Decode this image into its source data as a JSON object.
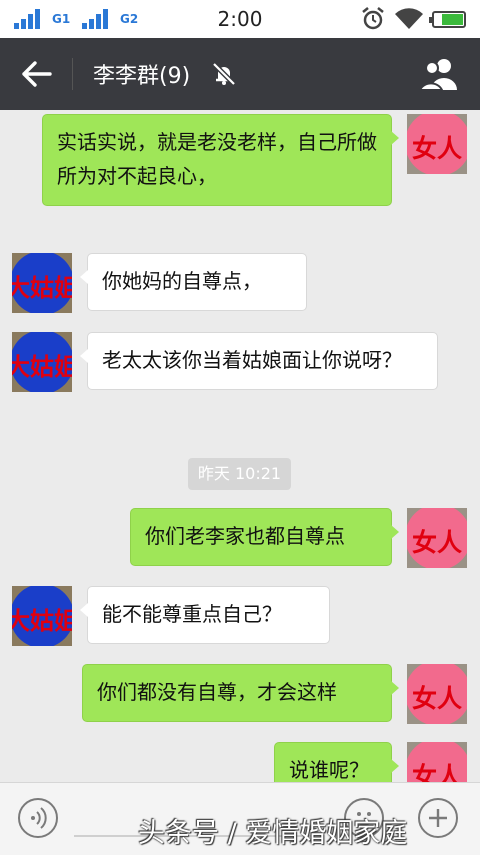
{
  "status_bar": {
    "sim1_label": "G1",
    "sim2_label": "G2",
    "time": "2:00",
    "icons": [
      "signal-icon",
      "alarm-icon",
      "wifi-icon",
      "battery-icon"
    ]
  },
  "header": {
    "title": "李李群(9)",
    "icons": [
      "back-arrow-icon",
      "mute-bell-icon",
      "group-members-icon"
    ],
    "background": "#393a3f"
  },
  "avatars": {
    "sister_label": "大姑姐",
    "woman_label": "女人"
  },
  "messages": [
    {
      "side": "out",
      "sender": "女人",
      "text": "实话实说，就是老没老样，自己所做所为对不起良心，"
    },
    {
      "side": "in",
      "sender": "大姑姐",
      "text": "你她妈的自尊点，"
    },
    {
      "side": "in",
      "sender": "大姑姐",
      "text": "老太太该你当着姑娘面让你说呀？"
    },
    {
      "side": "out",
      "sender": "女人",
      "text": "你们老李家也都自尊点"
    },
    {
      "side": "in",
      "sender": "大姑姐",
      "text": "能不能尊重点自己？"
    },
    {
      "side": "out",
      "sender": "女人",
      "text": "你们都没有自尊，才会这样"
    },
    {
      "side": "out",
      "sender": "女人",
      "text": "说谁呢？"
    }
  ],
  "timestamp": "昨天 10:21",
  "input_bar": {
    "icons": [
      "voice-icon",
      "emoji-icon",
      "plus-icon"
    ]
  },
  "watermark": "头条号 / 爱情婚姻家庭",
  "colors": {
    "outgoing_bubble": "#9fe658",
    "incoming_bubble": "#ffffff",
    "chat_background": "#ebebeb"
  }
}
